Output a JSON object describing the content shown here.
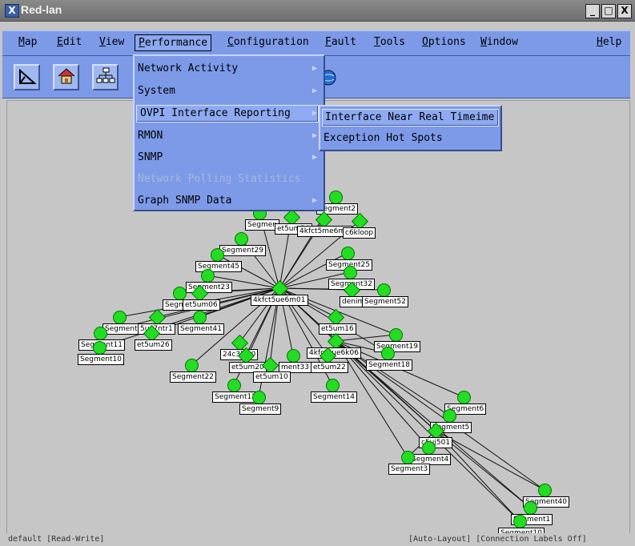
{
  "window": {
    "title": "Red-lan",
    "controls": [
      "_",
      "□",
      "X"
    ]
  },
  "menubar": {
    "items": [
      {
        "label": "Map",
        "underline": 0
      },
      {
        "label": "Edit",
        "underline": 0
      },
      {
        "label": "View",
        "underline": 0
      },
      {
        "label": "Performance",
        "underline": 0,
        "active": true
      },
      {
        "label": "Configuration",
        "underline": 0
      },
      {
        "label": "Fault",
        "underline": 0
      },
      {
        "label": "Tools",
        "underline": 0
      },
      {
        "label": "Options",
        "underline": 0
      },
      {
        "label": "Window",
        "underline": 0
      },
      {
        "label": "Help",
        "underline": 0
      }
    ]
  },
  "toolbar": {
    "icons": [
      "triangle-ruler-icon",
      "home-icon",
      "network-tree-icon",
      "globe-icon"
    ]
  },
  "performance_menu": {
    "items": [
      {
        "label": "Network Activity",
        "submenu": true
      },
      {
        "label": "System",
        "submenu": true
      },
      {
        "label": "OVPI Interface Reporting",
        "submenu": true,
        "highlighted": true
      },
      {
        "label": "RMON",
        "submenu": true
      },
      {
        "label": "SNMP",
        "submenu": true
      },
      {
        "label": "Network Polling Statistics",
        "disabled": true
      },
      {
        "label": "Graph SNMP Data",
        "submenu": true
      }
    ]
  },
  "submenu": {
    "items": [
      {
        "label": "Interface Near Real Timeime",
        "highlighted": true
      },
      {
        "label": "Exception Hot Spots"
      }
    ]
  },
  "map": {
    "node_color": "#22dd22",
    "nodes": [
      {
        "label": "4kfct5ue6m01",
        "shape": "diamond"
      },
      {
        "label": "Segment2",
        "shape": "circle"
      },
      {
        "label": "Segmen",
        "shape": "circle"
      },
      {
        "label": "et5um24",
        "shape": "diamond"
      },
      {
        "label": "4kfct5me6m0",
        "shape": "diamond"
      },
      {
        "label": "c6kloop",
        "shape": "diamond"
      },
      {
        "label": "Segment29",
        "shape": "circle"
      },
      {
        "label": "Segment45",
        "shape": "circle"
      },
      {
        "label": "Segment25",
        "shape": "circle"
      },
      {
        "label": "Segment23",
        "shape": "circle"
      },
      {
        "label": "Segment32",
        "shape": "circle"
      },
      {
        "label": "Segment",
        "shape": "circle"
      },
      {
        "label": "et5um06",
        "shape": "diamond"
      },
      {
        "label": "denim",
        "shape": "diamond"
      },
      {
        "label": "Segment52",
        "shape": "circle"
      },
      {
        "label": "Segment",
        "shape": "circle"
      },
      {
        "label": "5uc7ntr1",
        "shape": "diamond"
      },
      {
        "label": "Segment41",
        "shape": "circle"
      },
      {
        "label": "et5um16",
        "shape": "diamond"
      },
      {
        "label": "Segment11",
        "shape": "circle"
      },
      {
        "label": "et5um26",
        "shape": "diamond"
      },
      {
        "label": "Segment10",
        "shape": "circle"
      },
      {
        "label": "24c3lk00",
        "shape": "diamond"
      },
      {
        "label": "4kfct5ue6k06",
        "shape": "diamond"
      },
      {
        "label": "Segment19",
        "shape": "circle"
      },
      {
        "label": "et5um20",
        "shape": "diamond"
      },
      {
        "label": "ment33",
        "shape": "circle"
      },
      {
        "label": "Segment18",
        "shape": "circle"
      },
      {
        "label": "Segment22",
        "shape": "circle"
      },
      {
        "label": "et5um10",
        "shape": "diamond"
      },
      {
        "label": "et5um22",
        "shape": "diamond"
      },
      {
        "label": "Segment12",
        "shape": "circle"
      },
      {
        "label": "Segment14",
        "shape": "circle"
      },
      {
        "label": "Segment9",
        "shape": "circle"
      },
      {
        "label": "Segment6",
        "shape": "circle"
      },
      {
        "label": "Segment5",
        "shape": "circle"
      },
      {
        "label": "c5uj501",
        "shape": "diamond"
      },
      {
        "label": "Segment4",
        "shape": "circle"
      },
      {
        "label": "Segment3",
        "shape": "circle"
      },
      {
        "label": "Segment40",
        "shape": "circle"
      },
      {
        "label": "Segment1",
        "shape": "circle"
      },
      {
        "label": "Segment10",
        "shape": "circle"
      }
    ]
  },
  "statusbar": {
    "left": "default [Read-Write]",
    "right": "[Auto-Layout] [Connection Labels Off]"
  }
}
